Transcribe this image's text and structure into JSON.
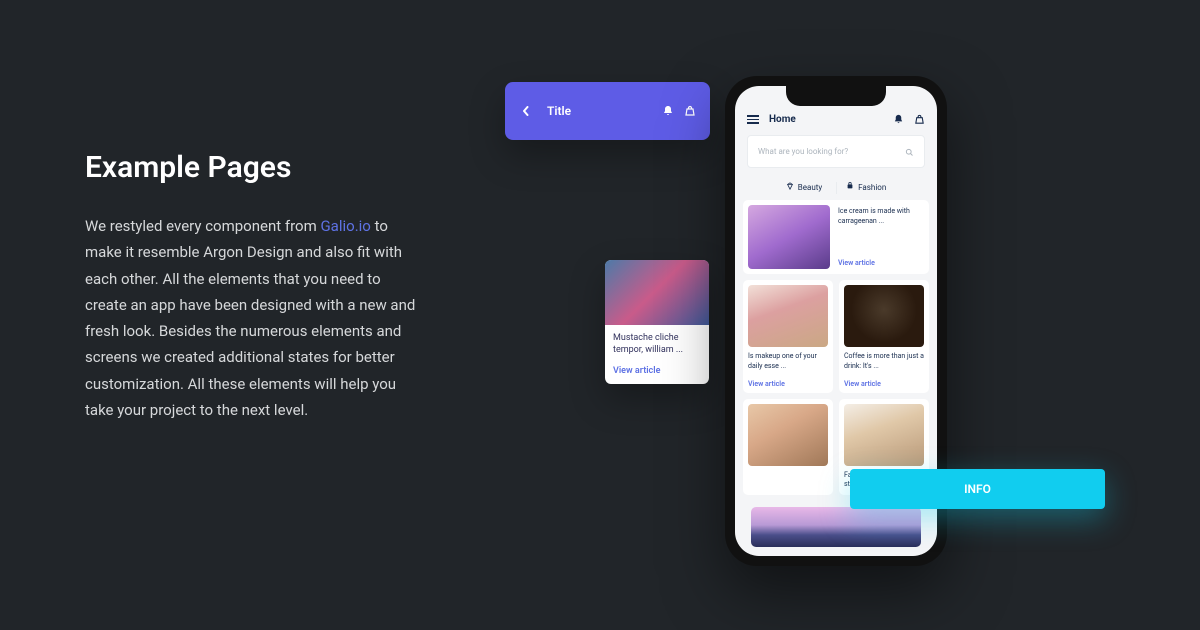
{
  "heading": "Example Pages",
  "description_before": "We restyled every component from ",
  "description_link": "Galio.io",
  "description_after": " to make it resemble Argon Design and also fit with each other. All the elements that you need to create an app have been designed with a new and fresh look. Besides the numerous elements and screens we created additional states for better customization. All these elements will help you take your project to the next level.",
  "titlebar": {
    "label": "Title"
  },
  "float_card": {
    "title": "Mustache cliche tempor, william ...",
    "link": "View article"
  },
  "phone": {
    "header_label": "Home",
    "search_placeholder": "What are you looking for?",
    "tabs": {
      "beauty": "Beauty",
      "fashion": "Fashion"
    },
    "articles": {
      "a0": {
        "title": "Ice cream is made with carrageenan ...",
        "link": "View article"
      },
      "a1": {
        "title": "Is makeup one of your daily esse ...",
        "link": "View article"
      },
      "a2": {
        "title": "Coffee is more than just a drink: It's ...",
        "link": "View article"
      },
      "a3": {
        "title": "",
        "link": ""
      },
      "a4": {
        "title": "Fashion is a popular style, especially in ...",
        "link": ""
      }
    }
  },
  "info_button": "INFO"
}
